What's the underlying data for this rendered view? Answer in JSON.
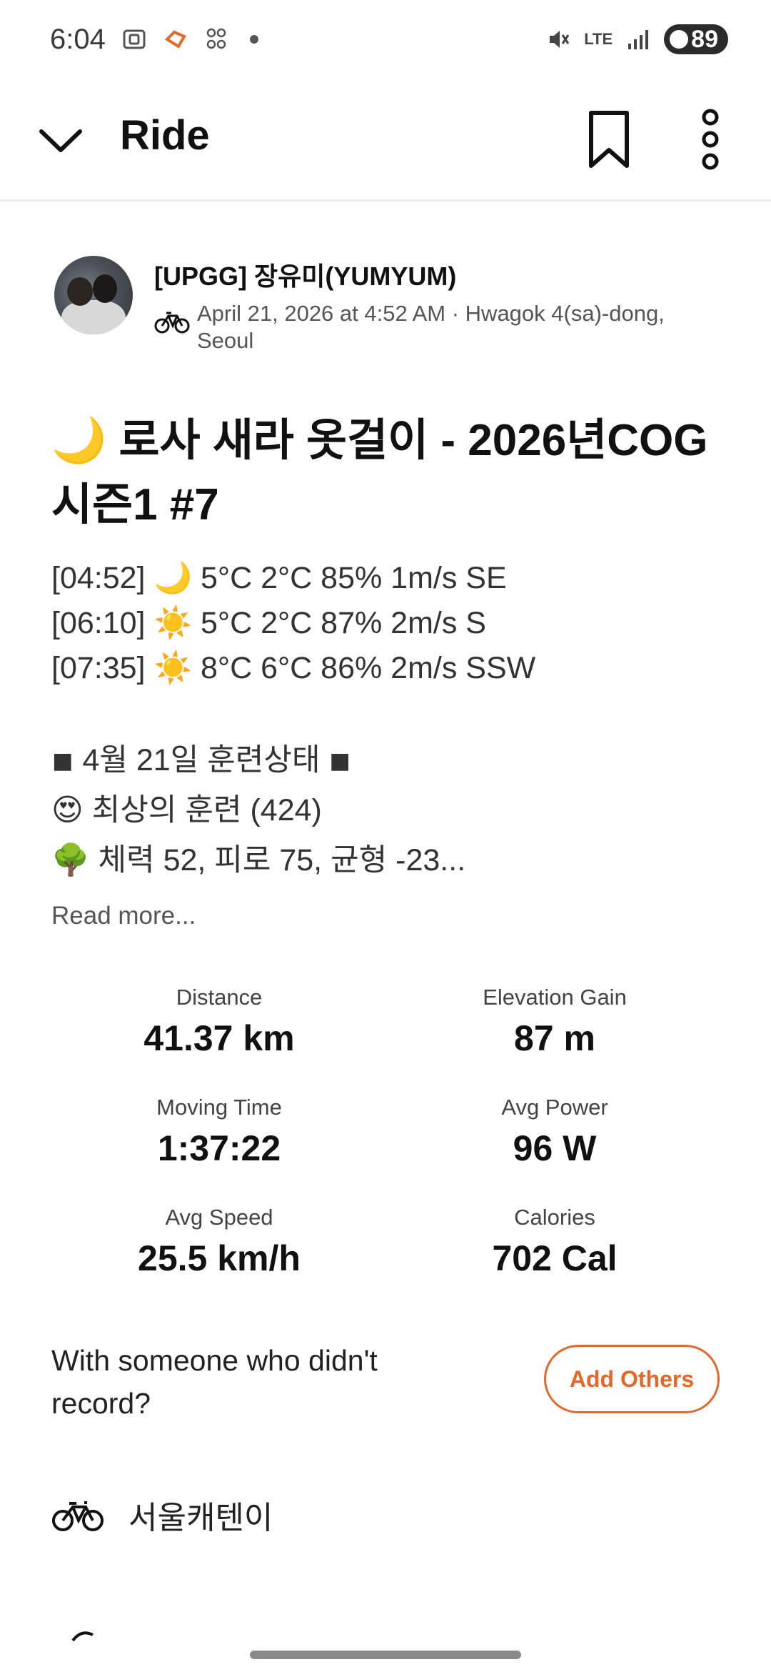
{
  "status_bar": {
    "time": "6:04",
    "battery": "89",
    "network": "LTE"
  },
  "header": {
    "title": "Ride",
    "icons": [
      "chevron-down-icon",
      "bookmark-icon",
      "more-vertical-icon"
    ]
  },
  "athlete": {
    "name": "[UPGG] 장유미(YUMYUM)",
    "meta": "April 21, 2026 at 4:52 AM · Hwagok 4(sa)-dong, Seoul"
  },
  "activity": {
    "title_emoji": "🌙",
    "title": "로사 새라 옷걸이 - 2026년COG시즌1 #7",
    "weather": [
      {
        "time": "[04:52]",
        "emoji": "🌙",
        "text": "5°C 2°C 85% 1m/s  SE"
      },
      {
        "time": "[06:10]",
        "emoji": "☀️",
        "text": "5°C 2°C 87% 2m/s  S"
      },
      {
        "time": "[07:35]",
        "emoji": "☀️",
        "text": "8°C 6°C 86% 2m/s  SSW"
      }
    ],
    "training_header": "◾ 4월 21일 훈련상태 ◾",
    "training_lines": [
      {
        "emoji": "😍",
        "text": "최상의 훈련 (424)"
      },
      {
        "emoji": "🌳",
        "text": "체력 52, 피로 75, 균형 -23..."
      }
    ],
    "read_more": "Read more..."
  },
  "stats": [
    {
      "label": "Distance",
      "value": "41.37 km"
    },
    {
      "label": "Elevation Gain",
      "value": "87 m"
    },
    {
      "label": "Moving Time",
      "value": "1:37:22"
    },
    {
      "label": "Avg Power",
      "value": "96 W"
    },
    {
      "label": "Avg Speed",
      "value": "25.5 km/h"
    },
    {
      "label": "Calories",
      "value": "702 Cal"
    }
  ],
  "with_others": {
    "prompt": "With someone who didn't record?",
    "button": "Add Others"
  },
  "gear": {
    "name": "서울캐텐이"
  },
  "colors": {
    "accent": "#e2682b"
  }
}
